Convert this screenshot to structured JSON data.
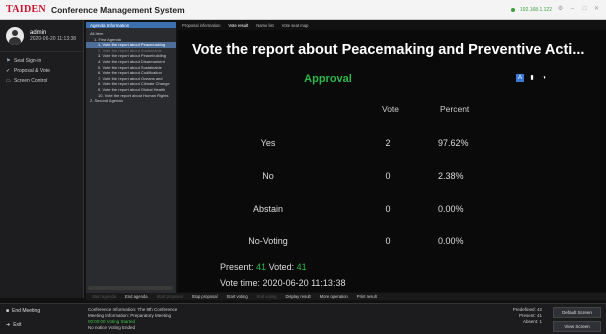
{
  "header": {
    "logo": "TAIDEN",
    "title": "Conference Management System",
    "ip": "192.168.1.122"
  },
  "sidebar": {
    "username": "admin",
    "datetime": "2020-06-20 11:13:38",
    "items": [
      {
        "label": "Seat Sign-in",
        "icon": "seat-icon"
      },
      {
        "label": "Proposal & Vote",
        "icon": "vote-icon"
      },
      {
        "label": "Screen Control",
        "icon": "screen-icon"
      }
    ],
    "end_meeting": "End Meeting",
    "exit": "Exit"
  },
  "agenda": {
    "tab": "Agenda Information",
    "items": [
      {
        "label": "All Item",
        "level": 0,
        "state": ""
      },
      {
        "label": "1. First Agenda",
        "level": 1,
        "state": ""
      },
      {
        "label": "1. Vote the report about Peacemaking",
        "level": 2,
        "state": "sel"
      },
      {
        "label": "2. Vote the report about Sustainable",
        "level": 2,
        "state": "dim"
      },
      {
        "label": "3. Vote the report about Peacebuilding",
        "level": 2,
        "state": ""
      },
      {
        "label": "4. Vote the report about Disarmament",
        "level": 2,
        "state": ""
      },
      {
        "label": "5. Vote the report about Sustainable",
        "level": 2,
        "state": ""
      },
      {
        "label": "6. Vote the report about Codification",
        "level": 2,
        "state": ""
      },
      {
        "label": "7. Vote the report about Oceans and",
        "level": 2,
        "state": ""
      },
      {
        "label": "8. Vote the report about Climate Change",
        "level": 2,
        "state": ""
      },
      {
        "label": "9. Vote the report about Global Health",
        "level": 2,
        "state": ""
      },
      {
        "label": "10. Vote the report about Human Rights",
        "level": 2,
        "state": ""
      },
      {
        "label": "2. Second Agenda",
        "level": 0,
        "state": ""
      }
    ]
  },
  "tabs": [
    "Proposal information",
    "Vote result",
    "Name list",
    "Vote seat map"
  ],
  "vote": {
    "title": "Vote the report about Peacemaking and Preventive Acti...",
    "status": "Approval",
    "col_vote": "Vote",
    "col_percent": "Percent",
    "rows": [
      {
        "label": "Yes",
        "vote": "2",
        "percent": "97.62%"
      },
      {
        "label": "No",
        "vote": "0",
        "percent": "2.38%"
      },
      {
        "label": "Abstain",
        "vote": "0",
        "percent": "0.00%"
      },
      {
        "label": "No-Voting",
        "vote": "0",
        "percent": "0.00%"
      }
    ],
    "present_label": "Present:",
    "present_value": "41",
    "voted_label": "Voted:",
    "voted_value": "41",
    "time_label": "Vote time:",
    "time_value": "2020-06-20 11:13:38"
  },
  "toolbar": [
    {
      "label": "Start agenda",
      "dim": true
    },
    {
      "label": "End agenda",
      "dim": false
    },
    {
      "label": "Start proposal",
      "dim": true
    },
    {
      "label": "Stop proposal",
      "dim": false
    },
    {
      "label": "Start voting",
      "dim": false
    },
    {
      "label": "End voting",
      "dim": true
    },
    {
      "label": "Display result",
      "dim": false
    },
    {
      "label": "More operation",
      "dim": false
    },
    {
      "label": "Print result",
      "dim": false
    }
  ],
  "footer": {
    "info_line1": "Conference Information:  The 8th Conference",
    "info_line2": "Meeting Information:  Preparatory Meeting",
    "info_line3": "00:00:00  Voting Started",
    "info_line4": "No notice  Voting Ended",
    "predefined_label": "Predefined:",
    "predefined_value": "42",
    "present_label": "Present:",
    "present_value": "41",
    "absent_label": "Absent:",
    "absent_value": "1",
    "btn_default_screen": "Default Screen",
    "btn_view_screen": "View Screen"
  },
  "colors": {
    "accent": "#3a78d6",
    "approval_green": "#2fb84a",
    "brand_red": "#c8102e"
  }
}
